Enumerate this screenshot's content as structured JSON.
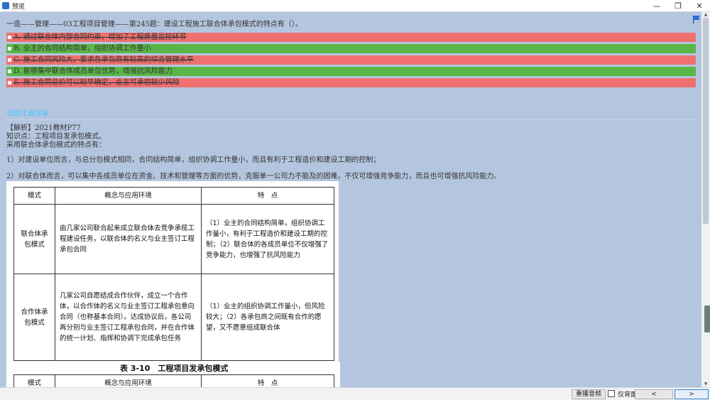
{
  "window": {
    "title": "预览",
    "minimize": "—",
    "restore": "❐",
    "close": "✕"
  },
  "question": {
    "text": "一造——管理——03工程项目管理——第245题：建设工程施工联合体承包模式的特点有（）。"
  },
  "options": [
    {
      "text": "A. 通过联合体内部合同约束，增加了工程质量监控环节",
      "status": "wrong"
    },
    {
      "text": "B. 业主的合同结构简单，组织协调工作量小",
      "status": "correct"
    },
    {
      "text": "C. 施工合同风险大，要求各承包商有较高的综合管理水平",
      "status": "wrong"
    },
    {
      "text": "D. 能够集中联合体成员单位优势，增强抗风险能力",
      "status": "correct"
    },
    {
      "text": "E. 施工合同总价可以较早确定，业主可承担较少风险",
      "status": "wrong"
    }
  ],
  "answer_label": "试题正确答案",
  "analysis": {
    "l1": "【解析】2021教材P77",
    "l2": "知识点：工程项目发承包模式。",
    "l3": "采用联合体承包模式的特点有：",
    "l4": "1）对建设单位而言，与总分包模式相同，合同结构简单，组织协调工作量小，而且有利于工程造价和建设工期的控制；",
    "l5": "2）对联合体而言，可以集中各成员单位在资金、技术和管理等方面的优势，克服单一公司力不能及的困难，不仅可增强竞争能力，而且也可增强抗风险能力。"
  },
  "table1": {
    "headers": [
      "模式",
      "概念与应用环境",
      "特　点"
    ],
    "rows": [
      {
        "mode": "联合体承包模式",
        "concept": "由几家公司联合起来成立联合体去竞争承揽工程建设任务，以联合体的名义与业主签订工程承包合同",
        "feature": "（1）业主的合同结构简单，组织协调工作量小，有利于工程造价和建设工期的控制；（2）联合体的各成员单位不仅增强了竞争能力，也增强了抗风险能力"
      },
      {
        "mode": "合作体承包模式",
        "concept": "几家公司自愿结成合作伙伴，成立一个合作体，以合作体的名义与业主签订工程承包意向合同（也称基本合同）。达成协议后，各公司再分别与业主签订工程承包合同，并在合作体的统一计划、指挥和协调下完成承包任务",
        "feature": "（1）业主的组织协调工作量小，但风险较大；（2）各承包商之间既有合作的愿望，又不愿意组成联合体"
      }
    ]
  },
  "table2": {
    "caption": "表 3-10　工程项目发承包模式",
    "headers": [
      "模式",
      "概念与应用环境",
      "特　点"
    ]
  },
  "bottom": {
    "replay": "重播音频",
    "bg_only": "仅背面",
    "prev": "<",
    "next": ">"
  },
  "colors": {
    "wrong": "#f07070",
    "correct": "#5ab647",
    "answer": "#4fc5ff",
    "background": "#b4c6df"
  }
}
